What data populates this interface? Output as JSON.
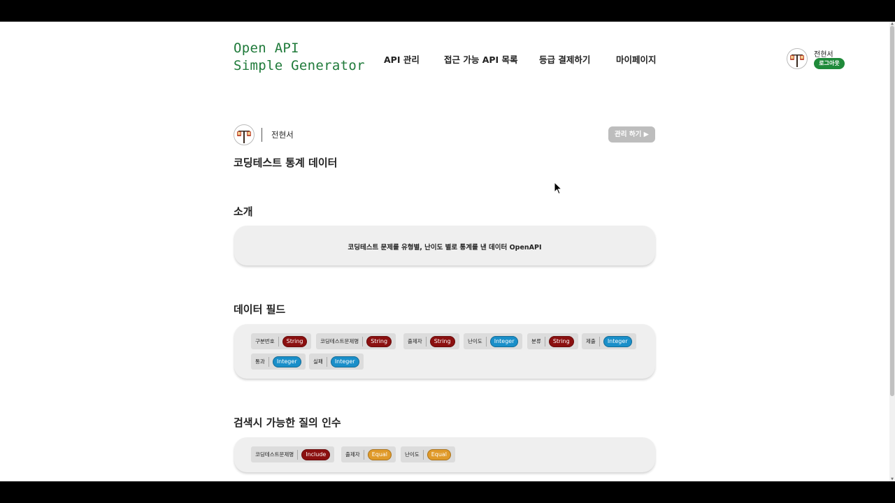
{
  "logo": {
    "line1": "Open API",
    "line2": "Simple Generator",
    "color": "#1f7a3a"
  },
  "nav": {
    "items": [
      {
        "label": "API 관리"
      },
      {
        "label": "접근 가능 API 목록"
      },
      {
        "label": "등급 결제하기"
      },
      {
        "label": "마이페이지"
      }
    ]
  },
  "user": {
    "name": "전현서",
    "logout_label": "로그아웃"
  },
  "owner": {
    "name": "전현서",
    "manage_label": "관리 하기 ▶"
  },
  "api": {
    "title": "코딩테스트 통계 데이터"
  },
  "intro": {
    "title": "소개",
    "text": "코딩테스트 문제를 유형별, 난이도 별로 통계를 낸 데이터 OpenAPI"
  },
  "fields": {
    "title": "데이터 필드",
    "items": [
      {
        "name": "구분번호",
        "type": "String"
      },
      {
        "name": "코딩테스트문제명",
        "type": "String"
      },
      {
        "name": "출제자",
        "type": "String"
      },
      {
        "name": "난이도",
        "type": "Integer"
      },
      {
        "name": "분류",
        "type": "String"
      },
      {
        "name": "제출",
        "type": "Integer"
      },
      {
        "name": "통과",
        "type": "Integer"
      },
      {
        "name": "실패",
        "type": "Integer"
      }
    ]
  },
  "queries": {
    "title": "검색시 가능한 질의 인수",
    "items": [
      {
        "name": "코딩테스트문제명",
        "op": "Include"
      },
      {
        "name": "출제자",
        "op": "Equal"
      },
      {
        "name": "난이도",
        "op": "Equal"
      }
    ]
  },
  "colors": {
    "string_tag": "#8b1010",
    "integer_tag": "#1a8fc9",
    "include_tag": "#8b1010",
    "equal_tag": "#e09a2a",
    "logout_bg": "#1f8a3a",
    "manage_bg": "#bdbdbd"
  }
}
